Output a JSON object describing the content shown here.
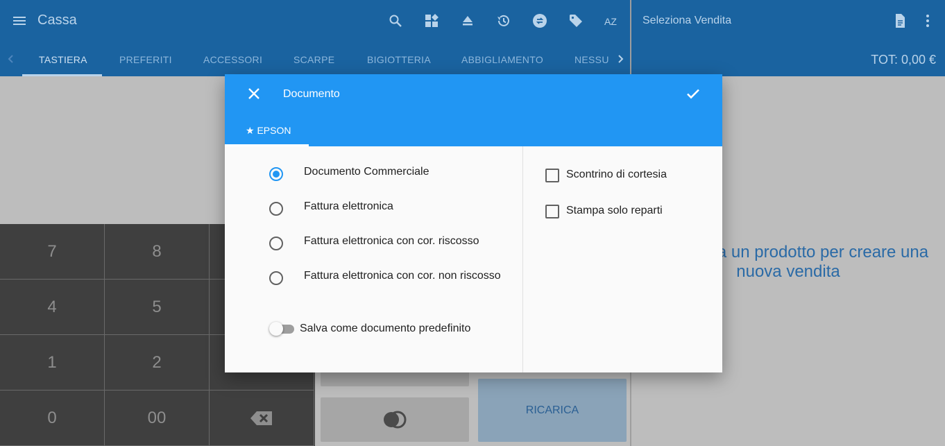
{
  "app": {
    "title": "Cassa",
    "menu_icon": "menu-icon",
    "toolbar_icons": [
      "search-icon",
      "dashboard-icon",
      "eject-icon",
      "history-icon",
      "currency-exchange-icon",
      "tag-icon",
      "sort-az-icon"
    ]
  },
  "tabs": {
    "items": [
      "TASTIERA",
      "PREFERITI",
      "ACCESSORI",
      "SCARPE",
      "BIGIOTTERIA",
      "ABBIGLIAMENTO",
      "NESSUI"
    ],
    "active": "TASTIERA"
  },
  "sale_panel": {
    "title": "Seleziona Vendita",
    "total": "TOT: 0,00 €",
    "empty_message_line1": "a un prodotto per creare una",
    "empty_message_line2": "nuova vendita"
  },
  "keypad": {
    "keys": [
      "7",
      "8",
      "4",
      "5",
      "1",
      "2",
      "0",
      "00"
    ],
    "backspace_icon": "backspace-icon"
  },
  "buttons": {
    "recharge": "RICARICA",
    "toggle_icon": "toggle-icon"
  },
  "dialog": {
    "title": "Documento",
    "tab": "★ EPSON",
    "options": [
      "Documento Commerciale",
      "Fattura elettronica",
      "Fattura elettronica con cor. riscosso",
      "Fattura elettronica con cor. non riscosso"
    ],
    "selected_option": "Documento Commerciale",
    "save_default": "Salva come documento predefinito",
    "save_default_on": false,
    "checkboxes": [
      "Scontrino di cortesia",
      "Stampa solo reparti"
    ],
    "checkboxes_checked": [
      false,
      false
    ]
  },
  "colors": {
    "appbar": "#1a63a0",
    "dialog_header": "#2196f3",
    "accent": "#2196f3",
    "message_text": "#2a6aa6"
  }
}
